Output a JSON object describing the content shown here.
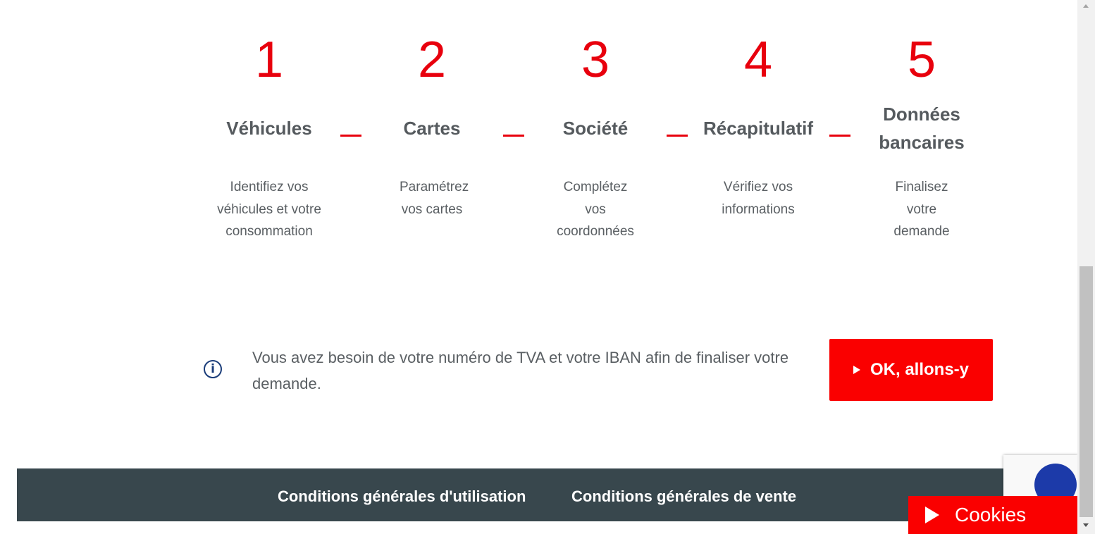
{
  "steps": [
    {
      "number": "1",
      "title": "Véhicules",
      "description": "Identifiez vos véhicules et votre consommation"
    },
    {
      "number": "2",
      "title": "Cartes",
      "description": "Paramétrez vos cartes"
    },
    {
      "number": "3",
      "title": "Société",
      "description": "Complétez vos coordonnées"
    },
    {
      "number": "4",
      "title": "Récapitulatif",
      "description": "Vérifiez vos informations"
    },
    {
      "number": "5",
      "title": "Données bancaires",
      "description": "Finalisez votre demande"
    }
  ],
  "info": {
    "icon": "info-icon",
    "text": "Vous avez besoin de votre numéro de TVA et votre IBAN afin de finaliser votre demande."
  },
  "cta": {
    "label": "OK, allons-y",
    "icon": "play-icon"
  },
  "footer": {
    "links": [
      {
        "label": "Conditions générales d'utilisation"
      },
      {
        "label": "Conditions générales de vente"
      }
    ]
  },
  "cookies": {
    "label": "Cookies",
    "icon": "play-icon"
  },
  "colors": {
    "accent": "#fa0000",
    "step_number": "#e8000d",
    "footer_bg": "#38474d",
    "text": "#5a5f63",
    "info_icon": "#1b3d7a"
  }
}
